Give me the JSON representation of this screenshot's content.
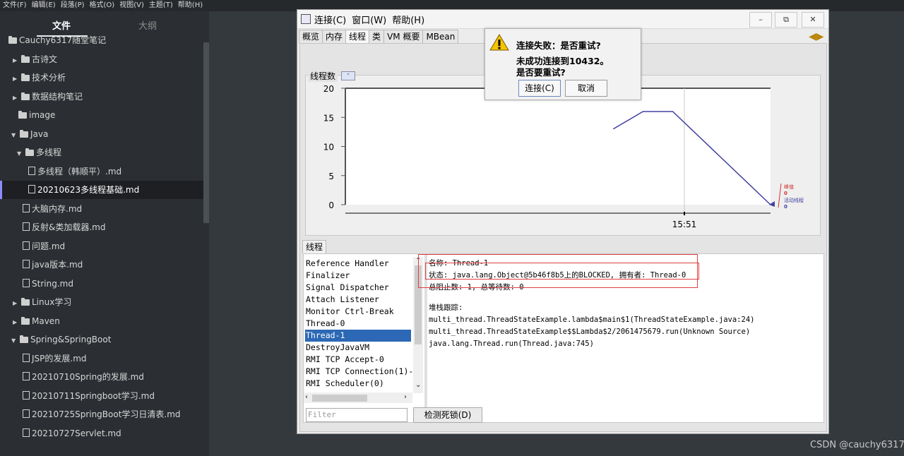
{
  "menubar": [
    "文件(F)",
    "编辑(E)",
    "段落(P)",
    "格式(O)",
    "视图(V)",
    "主题(T)",
    "帮助(H)"
  ],
  "sidebar": {
    "tab_files": "文件",
    "tab_outline": "大纲",
    "tree": [
      {
        "label": "Cauchy6317随堂笔记",
        "kind": "folder",
        "twisty": "none"
      },
      {
        "label": "古诗文",
        "kind": "folder",
        "twisty": "closed"
      },
      {
        "label": "技术分析",
        "kind": "folder",
        "twisty": "closed"
      },
      {
        "label": "数据结构笔记",
        "kind": "folder",
        "twisty": "closed"
      },
      {
        "label": "image",
        "kind": "folder",
        "twisty": "none"
      },
      {
        "label": "Java",
        "kind": "folder",
        "twisty": "open"
      },
      {
        "label": "多线程",
        "kind": "folder",
        "twisty": "open"
      },
      {
        "label": "多线程（韩顺平）.md",
        "kind": "file"
      },
      {
        "label": "20210623多线程基础.md",
        "kind": "file",
        "active": true
      },
      {
        "label": "大脑内存.md",
        "kind": "file"
      },
      {
        "label": "反射&类加载器.md",
        "kind": "file"
      },
      {
        "label": "问题.md",
        "kind": "file"
      },
      {
        "label": "java版本.md",
        "kind": "file"
      },
      {
        "label": "String.md",
        "kind": "file"
      },
      {
        "label": "Linux学习",
        "kind": "folder",
        "twisty": "closed"
      },
      {
        "label": "Maven",
        "kind": "folder",
        "twisty": "closed"
      },
      {
        "label": "Spring&SpringBoot",
        "kind": "folder",
        "twisty": "open"
      },
      {
        "label": "JSP的发展.md",
        "kind": "file"
      },
      {
        "label": "20210710Spring的发展.md",
        "kind": "file"
      },
      {
        "label": "20210711Springboot学习.md",
        "kind": "file"
      },
      {
        "label": "20210725SpringBoot学习日清表.md",
        "kind": "file"
      },
      {
        "label": "20210727Servlet.md",
        "kind": "file"
      }
    ]
  },
  "jconsole": {
    "menus": [
      "连接(C)",
      "窗口(W)",
      "帮助(H)"
    ],
    "window_buttons": {
      "minimize": "–",
      "restore": "⧉",
      "close": "✕"
    },
    "tabs": [
      "概览",
      "内存",
      "线程",
      "类",
      "VM 概要",
      "MBean"
    ],
    "selected_tab": "线程",
    "chart_section_title": "线程数",
    "list_section_title": "线程",
    "threads": [
      "Reference Handler",
      "Finalizer",
      "Signal Dispatcher",
      "Attach Listener",
      "Monitor Ctrl-Break",
      "Thread-0",
      "Thread-1",
      "DestroyJavaVM",
      "RMI TCP Accept-0",
      "RMI TCP Connection(1)-",
      "RMI Scheduler(0)"
    ],
    "selected_thread": "Thread-1",
    "details": {
      "name": "名称: Thread-1",
      "state": "状态: java.lang.Object@5b46f8b5上的BLOCKED, 拥有者: Thread-0",
      "counts": "总阻止数: 1, 总等待数: 0",
      "stack_title": "堆栈跟踪:",
      "stack": [
        "multi_thread.ThreadStateExample.lambda$main$1(ThreadStateExample.java:24)",
        "multi_thread.ThreadStateExample$$Lambda$2/2061475679.run(Unknown Source)",
        "java.lang.Thread.run(Thread.java:745)"
      ]
    },
    "filter_placeholder": "Filter",
    "deadlock_button": "检测死锁(D)"
  },
  "chart_data": {
    "type": "line",
    "title": "线程数",
    "y_ticks": [
      "20",
      "15",
      "10",
      "5",
      "0"
    ],
    "x_ticks": [
      "15:51"
    ],
    "ylim": [
      0,
      20
    ],
    "series": [
      {
        "name": "峰值",
        "color": "#d03030",
        "values": []
      },
      {
        "name": "活动线程",
        "color": "#4040a0",
        "points": [
          [
            0.63,
            13
          ],
          [
            0.7,
            16
          ],
          [
            0.77,
            16
          ],
          [
            1.0,
            0
          ]
        ]
      }
    ],
    "legend_values": {
      "峰值": "0",
      "活动线程": "0"
    }
  },
  "dialog": {
    "title": "连接失败：是否重试?",
    "message_line1": "未成功连接到10432。",
    "message_line2": "是否要重试?",
    "btn_connect": "连接(C)",
    "btn_cancel": "取消"
  },
  "watermark": "CSDN @cauchy6317"
}
